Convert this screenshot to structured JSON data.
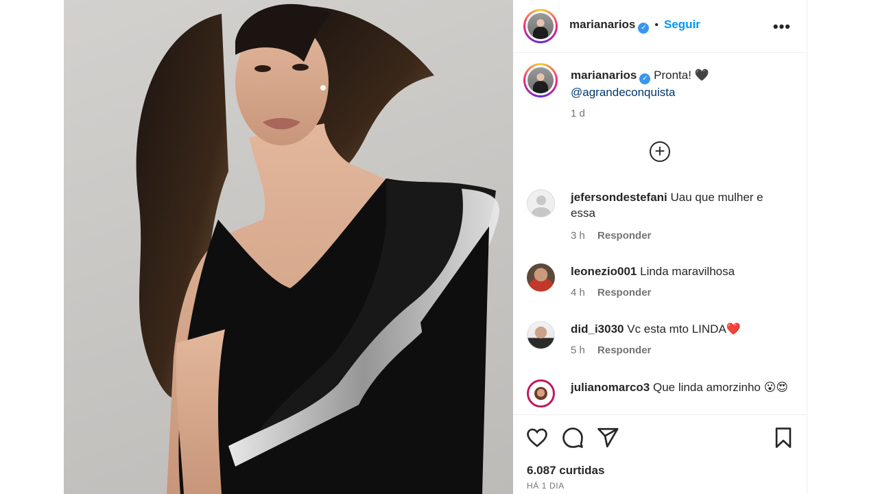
{
  "post": {
    "author": "marianarios",
    "follow_label": "Seguir",
    "separator": "•",
    "more": "•••",
    "verified_mark": "✓"
  },
  "caption": {
    "username": "marianarios",
    "text": "Pronta! 🖤",
    "mention": "@agrandeconquista",
    "time": "1 d"
  },
  "load_more_symbol": "+",
  "comments": [
    {
      "username": "jefersondestefani",
      "text": "Uau que mulher e essa",
      "time": "3 h",
      "reply": "Responder"
    },
    {
      "username": "leonezio001",
      "text": "Linda maravilhosa",
      "time": "4 h",
      "reply": "Responder"
    },
    {
      "username": "did_i3030",
      "text": "Vc esta mto LINDA❤️",
      "time": "5 h",
      "reply": "Responder"
    },
    {
      "username": "julianomarco3",
      "text": "Que linda amorzinho 😮😍",
      "time": "",
      "reply": ""
    }
  ],
  "footer": {
    "likes": "6.087 curtidas",
    "posted": "HÁ 1 DIA"
  },
  "icons": [
    "heart-icon",
    "comment-icon",
    "share-icon",
    "bookmark-icon",
    "plus-circle-icon",
    "verified-badge-icon",
    "more-options-icon"
  ],
  "colors": {
    "accent": "#0095f6",
    "verified": "#3897f0",
    "mention": "#00376b",
    "muted": "#737373"
  }
}
